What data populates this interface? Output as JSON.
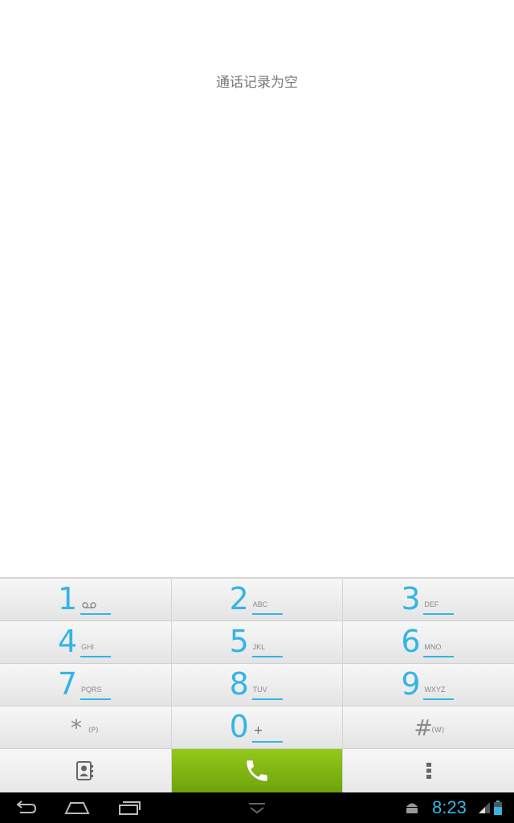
{
  "call_log": {
    "empty_message": "通话记录为空"
  },
  "dialpad": {
    "rows": [
      [
        {
          "digit": "1",
          "letters": ""
        },
        {
          "digit": "2",
          "letters": "ABC"
        },
        {
          "digit": "3",
          "letters": "DEF"
        }
      ],
      [
        {
          "digit": "4",
          "letters": "GHI"
        },
        {
          "digit": "5",
          "letters": "JKL"
        },
        {
          "digit": "6",
          "letters": "MNO"
        }
      ],
      [
        {
          "digit": "7",
          "letters": "PQRS"
        },
        {
          "digit": "8",
          "letters": "TUV"
        },
        {
          "digit": "9",
          "letters": "WXYZ"
        }
      ],
      [
        {
          "digit": "*",
          "letters": "(P)"
        },
        {
          "digit": "0",
          "letters": "+"
        },
        {
          "digit": "#",
          "letters": "(W)"
        }
      ]
    ]
  },
  "actions": {
    "contacts_icon": "contacts-icon",
    "call_icon": "phone-icon",
    "menu_icon": "overflow-menu-icon"
  },
  "status_bar": {
    "time": "8:23"
  },
  "colors": {
    "accent": "#33b5e5",
    "call_green": "#7fb813"
  }
}
